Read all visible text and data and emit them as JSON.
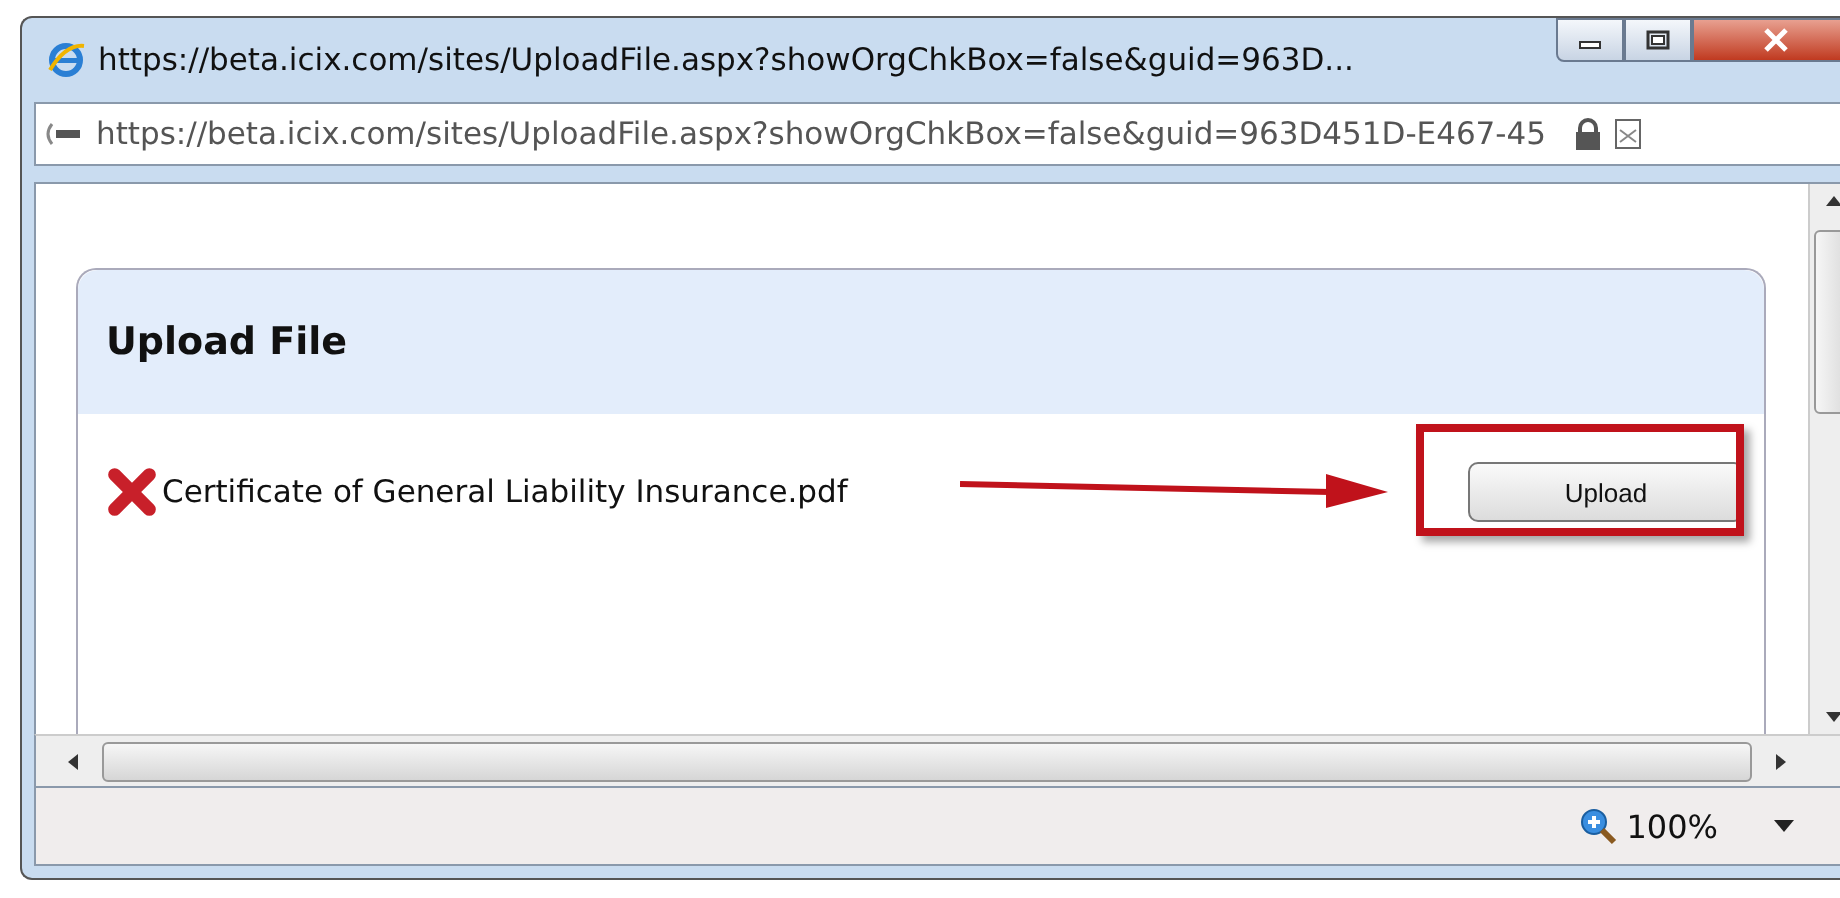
{
  "window": {
    "title": "https://beta.icix.com/sites/UploadFile.aspx?showOrgChkBox=false&guid=963D..."
  },
  "address_bar": {
    "url": "https://beta.icix.com/sites/UploadFile.aspx?showOrgChkBox=false&guid=963D451D-E467-45"
  },
  "panel": {
    "title": "Upload File",
    "file": {
      "name": "Certificate of General Liability Insurance.pdf"
    },
    "button": "Upload"
  },
  "status_bar": {
    "zoom": "100%"
  }
}
